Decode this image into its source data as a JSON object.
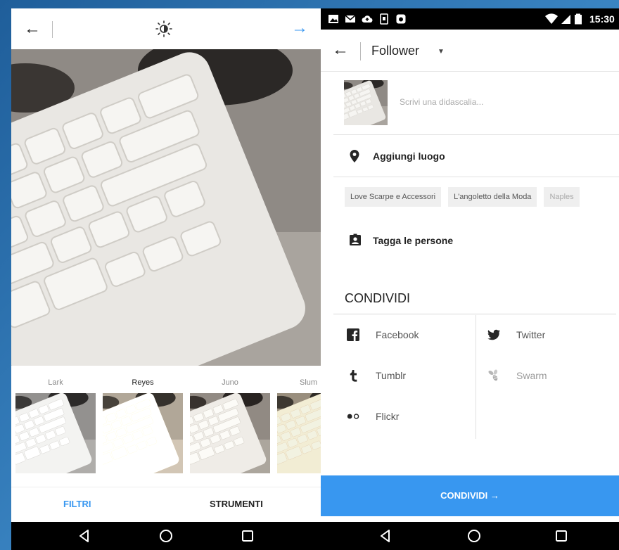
{
  "left": {
    "topbar": {
      "back_glyph": "←",
      "next_glyph": "→",
      "icon": "brightness-icon"
    },
    "filters": [
      {
        "name": "Lark"
      },
      {
        "name": "Reyes"
      },
      {
        "name": "Juno"
      },
      {
        "name": "Slum"
      }
    ],
    "tabs": {
      "filtri": "FILTRI",
      "strumenti": "STRUMENTI"
    },
    "accent": "#3897f0"
  },
  "right": {
    "status": {
      "time": "15:30"
    },
    "header": {
      "back_glyph": "←",
      "title": "Follower",
      "caret": "▼"
    },
    "caption": {
      "placeholder": "Scrivi una didascalia..."
    },
    "location": {
      "label": "Aggiungi luogo"
    },
    "location_chips": [
      "Love Scarpe e Accessori",
      "L'angoletto della Moda",
      "Naples"
    ],
    "tag": {
      "label": "Tagga le persone"
    },
    "share": {
      "title": "CONDIVIDI",
      "facebook": "Facebook",
      "twitter": "Twitter",
      "tumblr": "Tumblr",
      "swarm": "Swarm",
      "flickr": "Flickr"
    },
    "share_button": {
      "label": "CONDIVIDI →"
    }
  }
}
